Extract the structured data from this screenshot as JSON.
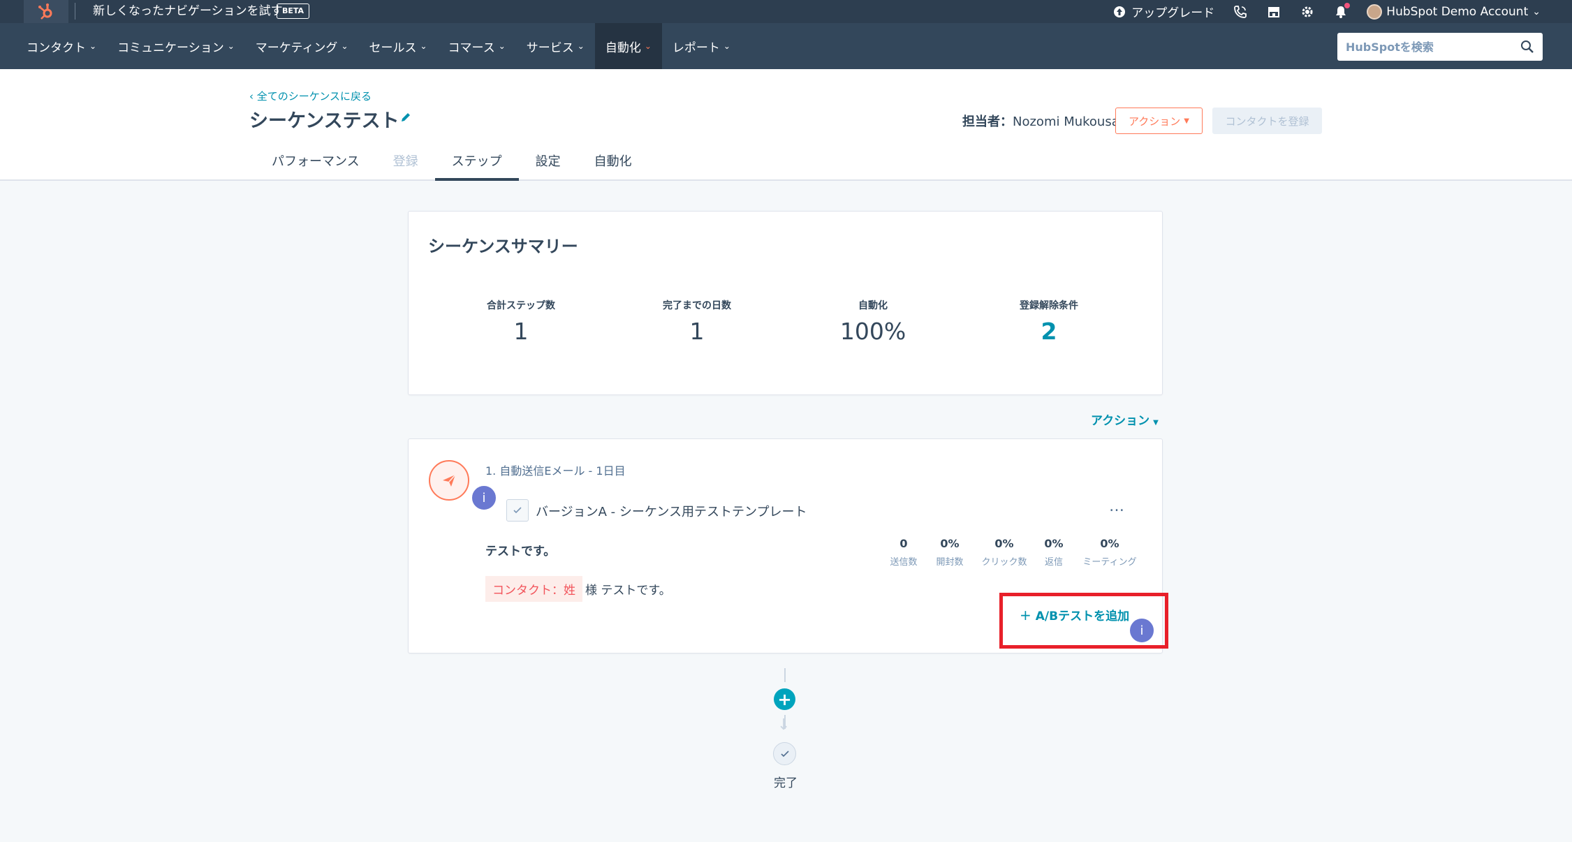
{
  "topbar": {
    "beta_text": "新しくなったナビゲーションを試す",
    "beta_badge": "BETA",
    "upgrade": "アップグレード",
    "account": "HubSpot Demo Account"
  },
  "nav": {
    "items": [
      {
        "label": "コンタクト"
      },
      {
        "label": "コミュニケーション"
      },
      {
        "label": "マーケティング"
      },
      {
        "label": "セールス"
      },
      {
        "label": "コマース"
      },
      {
        "label": "サービス"
      },
      {
        "label": "自動化"
      },
      {
        "label": "レポート"
      }
    ],
    "search_placeholder": "HubSpotを検索"
  },
  "header": {
    "back_link": "全てのシーケンスに戻る",
    "title": "シーケンステスト",
    "owner_label": "担当者：",
    "owner_name": "Nozomi Mukousa",
    "action_button": "アクション",
    "enroll_button": "コンタクトを登録",
    "tabs": [
      {
        "label": "パフォーマンス"
      },
      {
        "label": "登録"
      },
      {
        "label": "ステップ"
      },
      {
        "label": "設定"
      },
      {
        "label": "自動化"
      }
    ]
  },
  "summary": {
    "title": "シーケンスサマリー",
    "stats": [
      {
        "label": "合計ステップ数",
        "value": "1"
      },
      {
        "label": "完了までの日数",
        "value": "1"
      },
      {
        "label": "自動化",
        "value": "100%"
      },
      {
        "label": "登録解除条件",
        "value": "2"
      }
    ]
  },
  "actions_link": "アクション",
  "step": {
    "title": "1. 自動送信Eメール - 1日目",
    "info": "i",
    "version_label": "バージョンA - シーケンス用テストテンプレート",
    "subject": "テストです。",
    "metrics": [
      {
        "value": "0",
        "label": "送信数"
      },
      {
        "value": "0%",
        "label": "開封数"
      },
      {
        "value": "0%",
        "label": "クリック数"
      },
      {
        "value": "0%",
        "label": "返信"
      },
      {
        "value": "0%",
        "label": "ミーティング"
      }
    ],
    "token": "コンタクト：姓",
    "body_rest": "様 テストです。",
    "ab_test_link": "A/Bテストを追加"
  },
  "flow": {
    "done_label": "完了"
  },
  "colors": {
    "topbar": "#2d3e50",
    "nav": "#33475b",
    "accent_orange": "#ff7a59",
    "link_teal": "#0091ae",
    "highlight_red": "#e8202a",
    "info_purple": "#6a78d1"
  }
}
